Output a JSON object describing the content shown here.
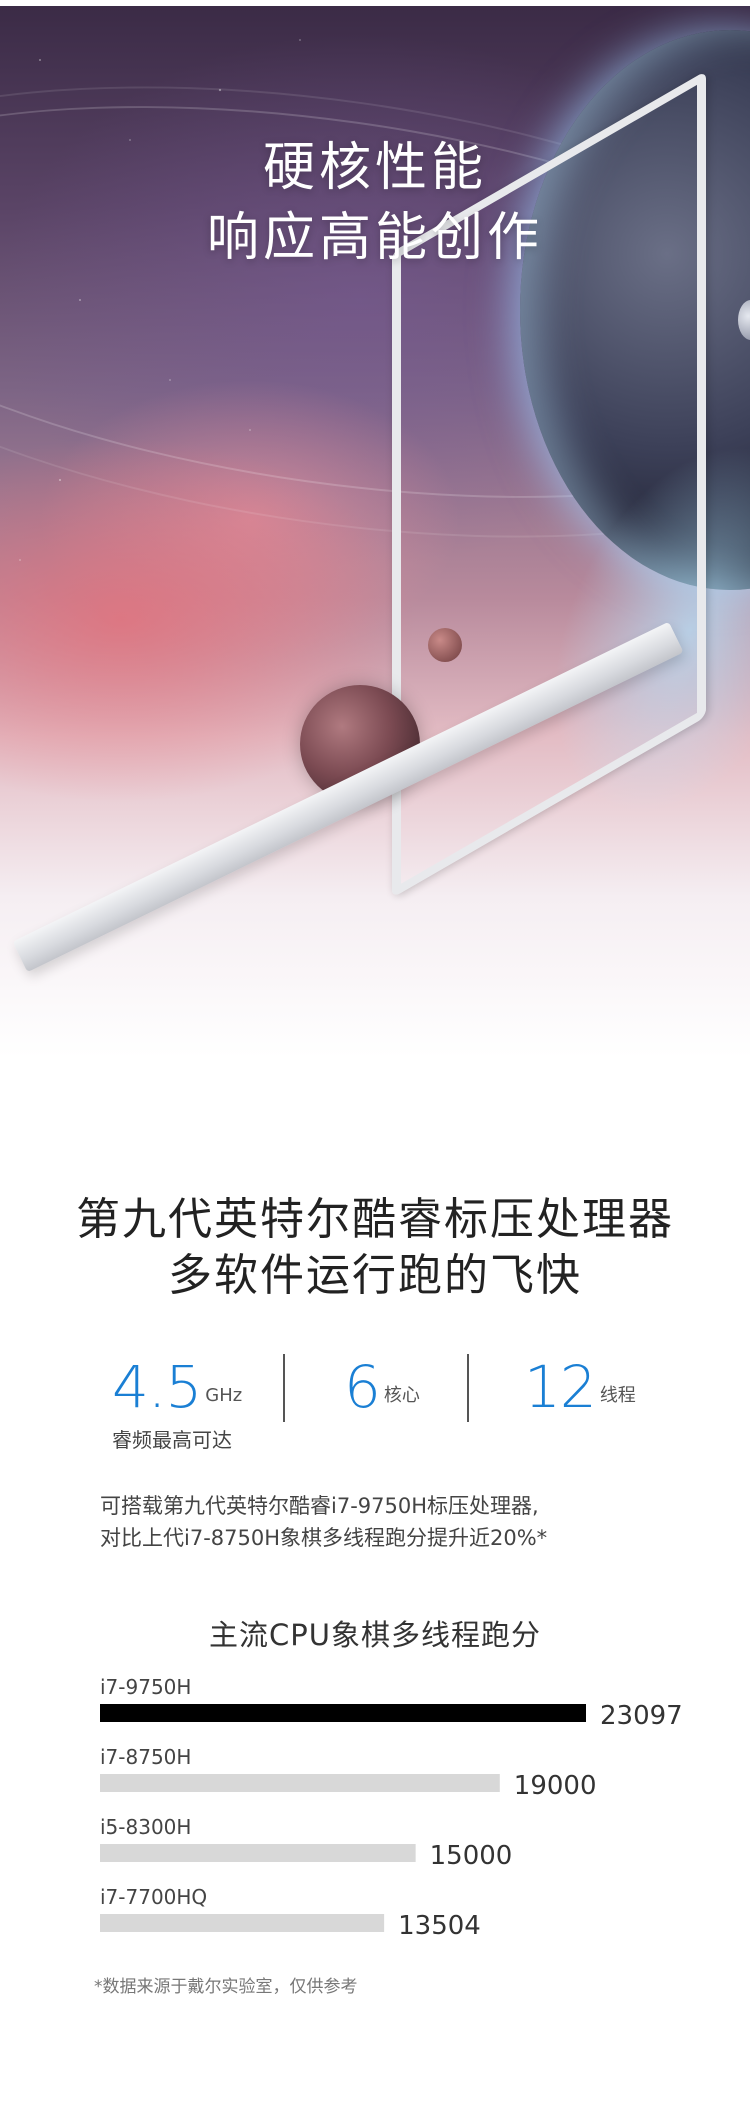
{
  "hero": {
    "title_line1": "硬核性能",
    "title_line2": "响应高能创作"
  },
  "headline": {
    "line1": "第九代英特尔酷睿标压处理器",
    "line2": "多软件运行跑的飞快"
  },
  "specs": [
    {
      "value": "4.5",
      "unit": "GHz",
      "sub": "睿频最高可达"
    },
    {
      "value": "6",
      "unit": "核心",
      "sub": ""
    },
    {
      "value": "12",
      "unit": "线程",
      "sub": ""
    }
  ],
  "description": {
    "line1": "可搭载第九代英特尔酷睿i7-9750H标压处理器,",
    "line2": "对比上代i7-8750H象棋多线程跑分提升近20%*"
  },
  "colors": {
    "accent": "#1a7fd4",
    "bar_highlight": "#000000",
    "bar_default": "#d8d8d8"
  },
  "chart_data": {
    "type": "bar",
    "orientation": "horizontal",
    "title": "主流CPU象棋多线程跑分",
    "categories": [
      "i7-9750H",
      "i7-8750H",
      "i5-8300H",
      "i7-7700HQ"
    ],
    "values": [
      23097,
      19000,
      15000,
      13504
    ],
    "highlight_index": 0
  },
  "footnote": "*数据来源于戴尔实验室，仅供参考"
}
